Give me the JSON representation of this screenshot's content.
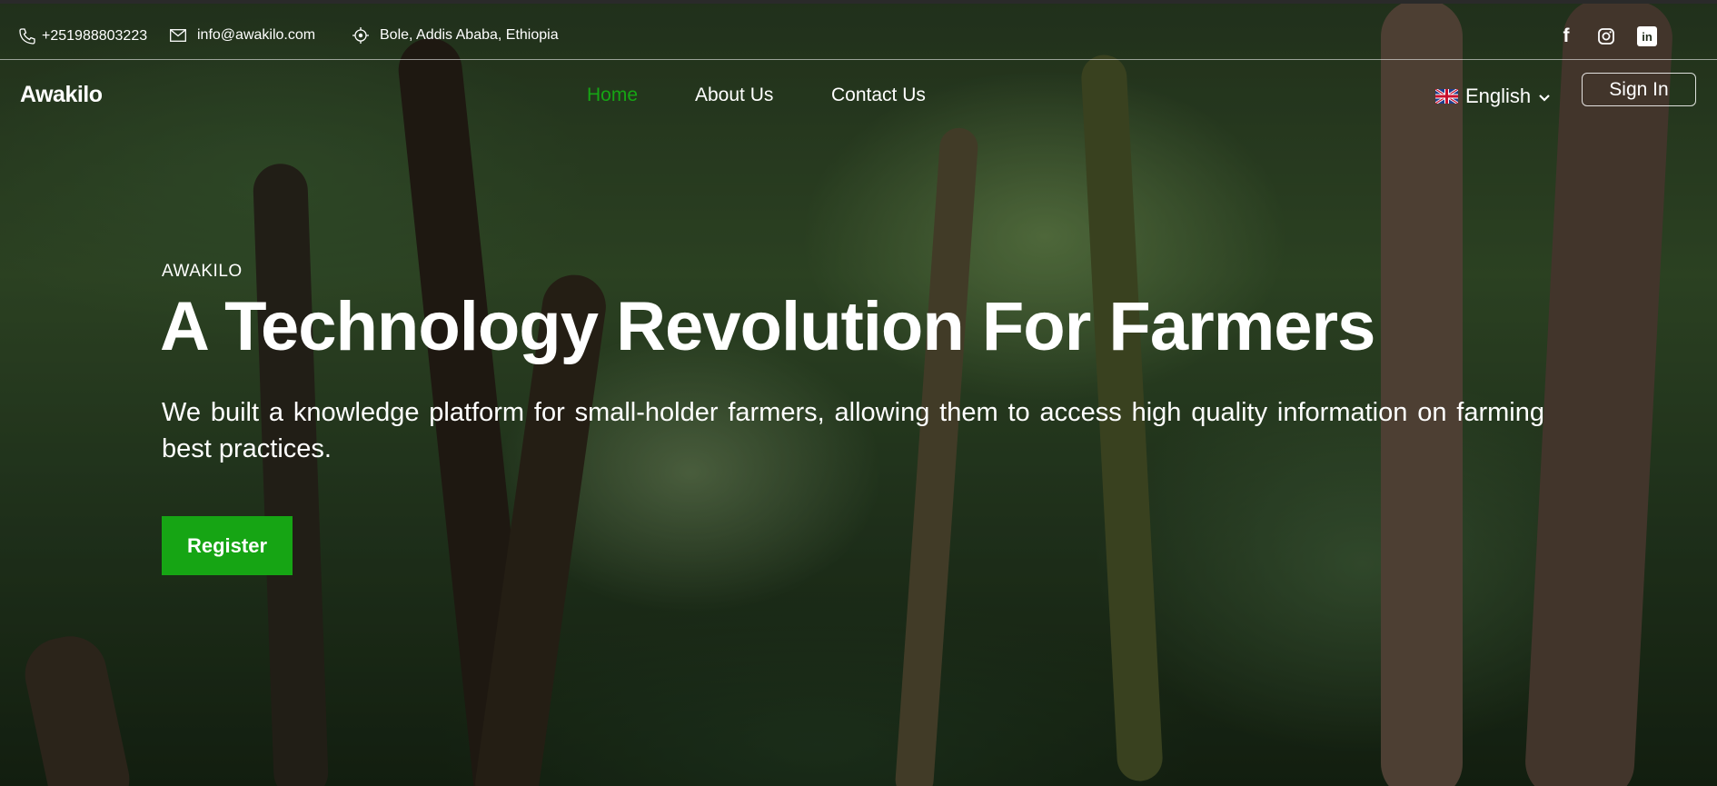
{
  "contact": {
    "phone": "+251988803223",
    "email": "info@awakilo.com",
    "address": "Bole, Addis Ababa, Ethiopia"
  },
  "social": {
    "facebook_glyph": "f",
    "linkedin_glyph": "in"
  },
  "nav": {
    "logo": "Awakilo",
    "links": [
      "Home",
      "About Us",
      "Contact Us"
    ],
    "active": "Home",
    "language": "English",
    "signin_label": "Sign In"
  },
  "hero": {
    "eyebrow": "AWAKILO",
    "headline": "A Technology Revolution For Farmers",
    "description": "We built a knowledge platform for small-holder farmers, allowing them to access high quality information on farming best practices.",
    "cta_label": "Register"
  },
  "colors": {
    "accent_green": "#16a514",
    "text": "#ffffff"
  },
  "icons": [
    "phone-icon",
    "mail-icon",
    "location-icon",
    "facebook-icon",
    "instagram-icon",
    "linkedin-icon",
    "chevron-down-icon",
    "uk-flag-icon"
  ]
}
